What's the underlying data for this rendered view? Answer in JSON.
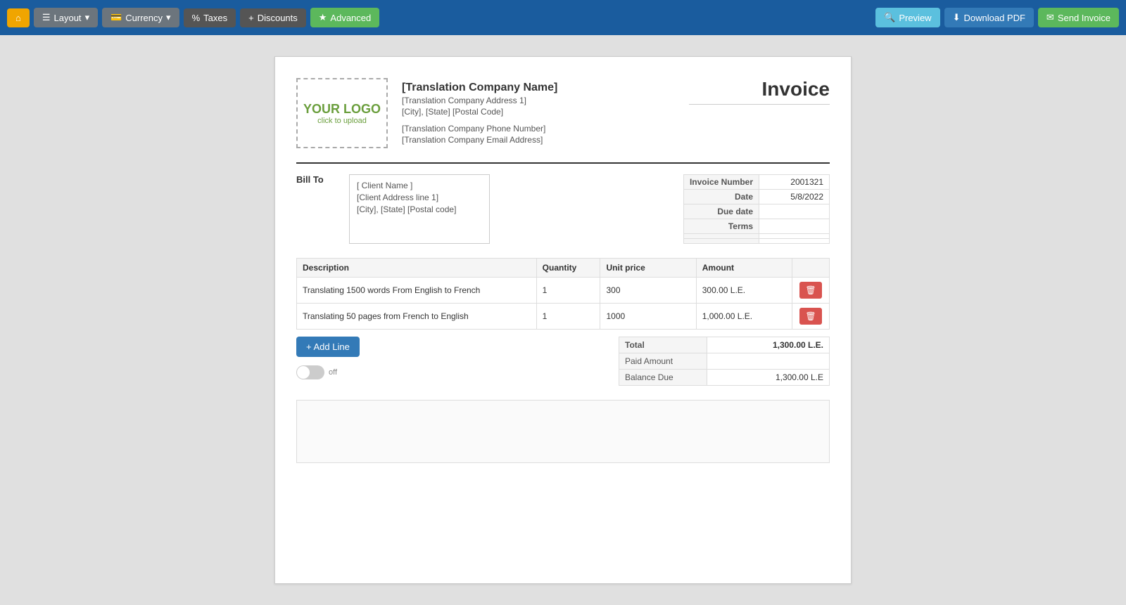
{
  "toolbar": {
    "home_label": "",
    "layout_label": "Layout",
    "currency_label": "Currency",
    "taxes_label": "Taxes",
    "discounts_label": "Discounts",
    "advanced_label": "Advanced",
    "preview_label": "Preview",
    "download_label": "Download PDF",
    "send_label": "Send Invoice"
  },
  "invoice": {
    "title": "Invoice",
    "logo_text": "YOUR LOGO",
    "logo_subtext": "click to upload",
    "company": {
      "name": "[Translation Company Name]",
      "address1": "[Translation Company Address 1]",
      "address2": "[City], [State] [Postal Code]",
      "phone": "[Translation Company Phone Number]",
      "email": "[Translation Company Email Address]"
    },
    "bill_to_label": "Bill To",
    "client": {
      "name": "[ Client Name ]",
      "address1": "[Client Address line 1]",
      "address2": "[City], [State] [Postal code]"
    },
    "details": {
      "invoice_number_label": "Invoice Number",
      "invoice_number_value": "2001321",
      "date_label": "Date",
      "date_value": "5/8/2022",
      "due_date_label": "Due date",
      "due_date_value": "",
      "terms_label": "Terms",
      "terms_value": "",
      "extra1_label": "",
      "extra1_value": "",
      "extra2_label": "",
      "extra2_value": ""
    },
    "table_headers": {
      "description": "Description",
      "quantity": "Quantity",
      "unit_price": "Unit price",
      "amount": "Amount"
    },
    "line_items": [
      {
        "description": "Translating 1500 words From English to French",
        "quantity": "1",
        "unit_price": "300",
        "amount": "300.00 L.E."
      },
      {
        "description": "Translating 50 pages from French to English",
        "quantity": "1",
        "unit_price": "1000",
        "amount": "1,000.00 L.E."
      }
    ],
    "add_line_label": "+ Add Line",
    "totals": {
      "total_label": "Total",
      "total_value": "1,300.00 L.E.",
      "paid_amount_label": "Paid Amount",
      "paid_amount_value": "",
      "balance_due_label": "Balance Due",
      "balance_due_value": "1,300.00 L.E"
    },
    "toggle_label": "off"
  }
}
